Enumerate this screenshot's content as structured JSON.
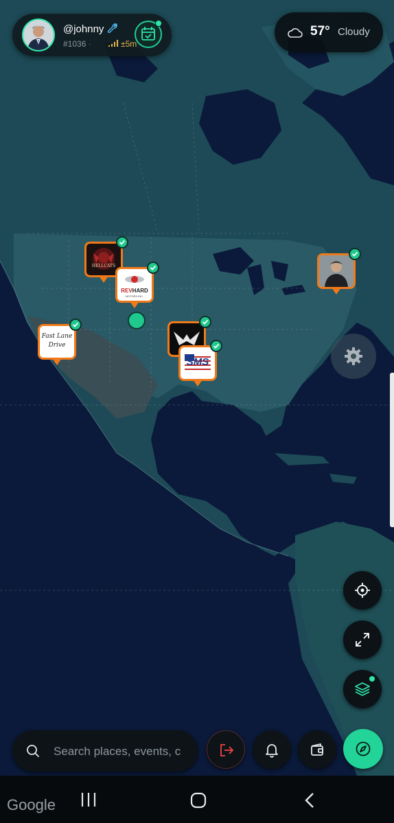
{
  "profile": {
    "username": "@johnny",
    "user_id": "#1036",
    "separator": "·",
    "accuracy": "±5m"
  },
  "weather": {
    "temperature": "57°",
    "condition": "Cloudy"
  },
  "map": {
    "attribution": "Google",
    "pins": [
      {
        "id": "hellcats",
        "logo_text": "HELLCATS"
      },
      {
        "id": "revhard",
        "logo_text_red": "REV",
        "logo_text_dark": "HARD",
        "logo_subtext": "MOTORS INC."
      },
      {
        "id": "fastlane",
        "logo_text_1": "Fast Lane",
        "logo_text_2": "Drive"
      },
      {
        "id": "dark-logo"
      },
      {
        "id": "sms",
        "logo_text": "SMS"
      },
      {
        "id": "person"
      }
    ]
  },
  "search": {
    "placeholder": "Search places, events, c"
  },
  "icons": {
    "wrench": "wrench-icon",
    "signal": "signal-icon",
    "calendar": "calendar-check-icon",
    "weather": "cloud-icon",
    "settings": "gear-icon",
    "locate": "crosshair-icon",
    "expand": "expand-icon",
    "layers": "layers-icon",
    "search": "search-icon",
    "logout": "logout-icon",
    "bell": "bell-icon",
    "wallet": "wallet-icon",
    "compass": "compass-icon"
  },
  "colors": {
    "accent": "#22d497",
    "pin_border": "#f07a1a",
    "ocean": "#0b1a3a",
    "land": "#1d4a56"
  }
}
